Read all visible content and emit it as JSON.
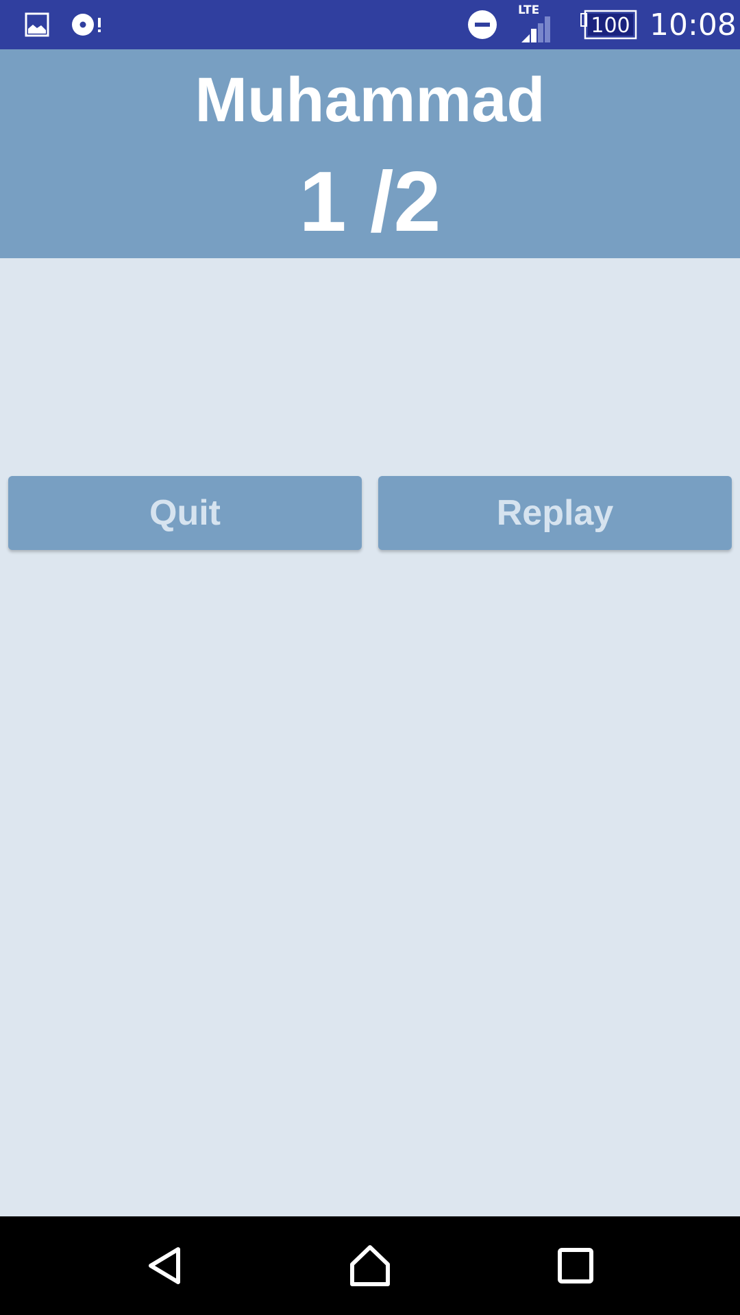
{
  "status_bar": {
    "time": "10:08",
    "battery": "100",
    "network": "LTE",
    "icons": [
      "image-icon",
      "disc-alert-icon",
      "do-not-disturb-icon",
      "signal-icon",
      "battery-icon"
    ]
  },
  "header": {
    "player_name": "Muhammad",
    "score": "1 /2"
  },
  "actions": {
    "quit_label": "Quit",
    "replay_label": "Replay"
  },
  "nav_bar": {
    "icons": [
      "back-icon",
      "home-icon",
      "recents-icon"
    ]
  },
  "colors": {
    "status_bar": "#303f9f",
    "header": "#789fc2",
    "background": "#dde6ef",
    "button": "#789fc2",
    "button_text": "#d6e3ef",
    "nav_bar": "#000000"
  }
}
